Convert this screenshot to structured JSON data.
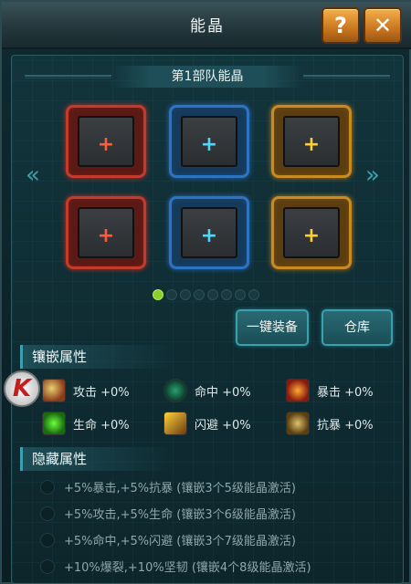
{
  "header": {
    "title": "能晶",
    "help_label": "?",
    "close_label": "✕"
  },
  "squad": {
    "title": "第1部队能晶"
  },
  "slots": [
    {
      "color": "red",
      "symbol": "+"
    },
    {
      "color": "blue",
      "symbol": "+"
    },
    {
      "color": "gold",
      "symbol": "+"
    },
    {
      "color": "red",
      "symbol": "+"
    },
    {
      "color": "blue",
      "symbol": "+"
    },
    {
      "color": "gold",
      "symbol": "+"
    }
  ],
  "nav": {
    "left_arrow": "«",
    "right_arrow": "»"
  },
  "pagination": {
    "current": 1,
    "total": 8
  },
  "buttons": {
    "equip_all": "一键装备",
    "storage": "仓库"
  },
  "inlay_section": {
    "title": "镶嵌属性",
    "stats": [
      {
        "icon": "attack-icon",
        "label": "攻击 +0%"
      },
      {
        "icon": "hit-icon",
        "label": "命中 +0%"
      },
      {
        "icon": "crit-icon",
        "label": "暴击 +0%"
      },
      {
        "icon": "life-icon",
        "label": "生命 +0%"
      },
      {
        "icon": "dodge-icon",
        "label": "闪避 +0%"
      },
      {
        "icon": "anti-crit-icon",
        "label": "抗暴 +0%"
      }
    ]
  },
  "hidden_section": {
    "title": "隐藏属性",
    "rows": [
      "+5%暴击,+5%抗暴   (镶嵌3个5级能晶激活)",
      "+5%攻击,+5%生命   (镶嵌3个6级能晶激活)",
      "+5%命中,+5%闪避   (镶嵌3个7级能晶激活)",
      "+10%爆裂,+10%坚韧   (镶嵌4个8级能晶激活)"
    ]
  },
  "colors": {
    "red": "#c23b2c",
    "blue": "#2c74c2",
    "gold": "#c98a22",
    "accent": "#3aa0ae"
  }
}
